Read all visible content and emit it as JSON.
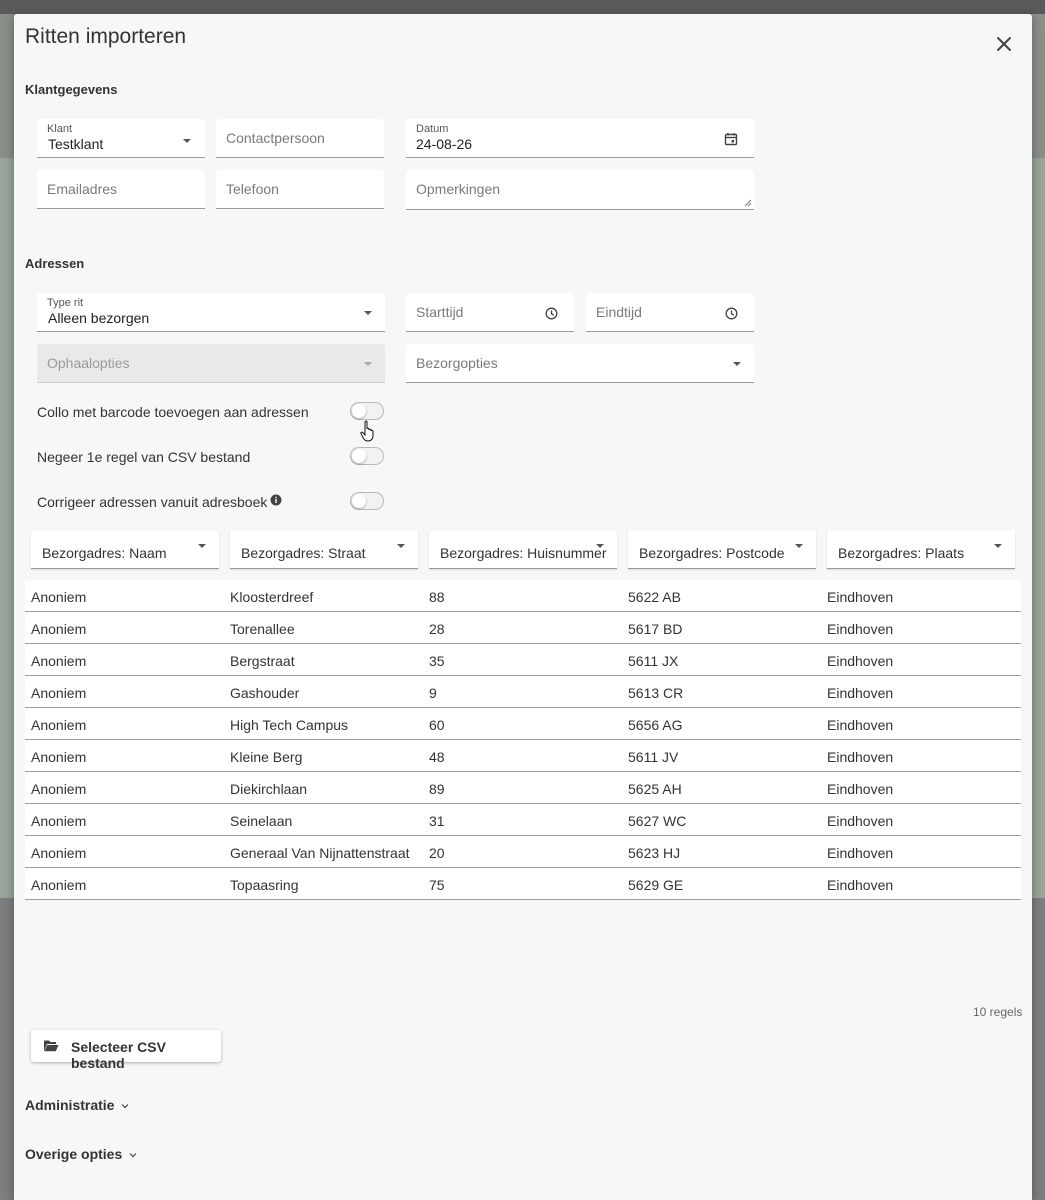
{
  "modal": {
    "title": "Ritten importeren"
  },
  "klantgegevens": {
    "title": "Klantgegevens",
    "klant": {
      "label": "Klant",
      "value": "Testklant"
    },
    "contactpersoon": {
      "placeholder": "Contactpersoon"
    },
    "datum": {
      "label": "Datum",
      "value": "24-08-26"
    },
    "emailadres": {
      "placeholder": "Emailadres"
    },
    "telefoon": {
      "placeholder": "Telefoon"
    },
    "opmerkingen": {
      "placeholder": "Opmerkingen"
    }
  },
  "adressen": {
    "title": "Adressen",
    "type_rit": {
      "label": "Type rit",
      "value": "Alleen bezorgen"
    },
    "starttijd": {
      "placeholder": "Starttijd"
    },
    "eindtijd": {
      "placeholder": "Eindtijd"
    },
    "ophaalopties": {
      "placeholder": "Ophaalopties"
    },
    "bezorgopties": {
      "placeholder": "Bezorgopties"
    },
    "toggles": [
      {
        "label": "Collo met barcode toevoegen aan adressen",
        "on": false
      },
      {
        "label": "Negeer 1e regel van CSV bestand",
        "on": false
      },
      {
        "label": "Corrigeer adressen vanuit adresboek",
        "on": false
      }
    ]
  },
  "columns": [
    "Bezorgadres: Naam",
    "Bezorgadres: Straat",
    "Bezorgadres: Huisnummer",
    "Bezorgadres: Postcode",
    "Bezorgadres: Plaats"
  ],
  "rows": [
    [
      "Anoniem",
      "Kloosterdreef",
      "88",
      "5622 AB",
      "Eindhoven"
    ],
    [
      "Anoniem",
      "Torenallee",
      "28",
      "5617 BD",
      "Eindhoven"
    ],
    [
      "Anoniem",
      "Bergstraat",
      "35",
      "5611 JX",
      "Eindhoven"
    ],
    [
      "Anoniem",
      "Gashouder",
      "9",
      "5613 CR",
      "Eindhoven"
    ],
    [
      "Anoniem",
      "High Tech Campus",
      "60",
      "5656 AG",
      "Eindhoven"
    ],
    [
      "Anoniem",
      "Kleine Berg",
      "48",
      "5611 JV",
      "Eindhoven"
    ],
    [
      "Anoniem",
      "Diekirchlaan",
      "89",
      "5625 AH",
      "Eindhoven"
    ],
    [
      "Anoniem",
      "Seinelaan",
      "31",
      "5627 WC",
      "Eindhoven"
    ],
    [
      "Anoniem",
      "Generaal Van Nijnattenstraat",
      "20",
      "5623 HJ",
      "Eindhoven"
    ],
    [
      "Anoniem",
      "Topaasring",
      "75",
      "5629 GE",
      "Eindhoven"
    ]
  ],
  "row_count": "10 regels",
  "csv_button": {
    "label": "Selecteer CSV bestand",
    "icon": "folder-open-icon"
  },
  "sections_collapsed": [
    {
      "label": "Administratie"
    },
    {
      "label": "Overige opties"
    }
  ],
  "colors": {
    "modal_bg": "#f7f7f7",
    "field_bg": "#ffffff",
    "text": "#333333",
    "border": "#9e9e9e"
  }
}
